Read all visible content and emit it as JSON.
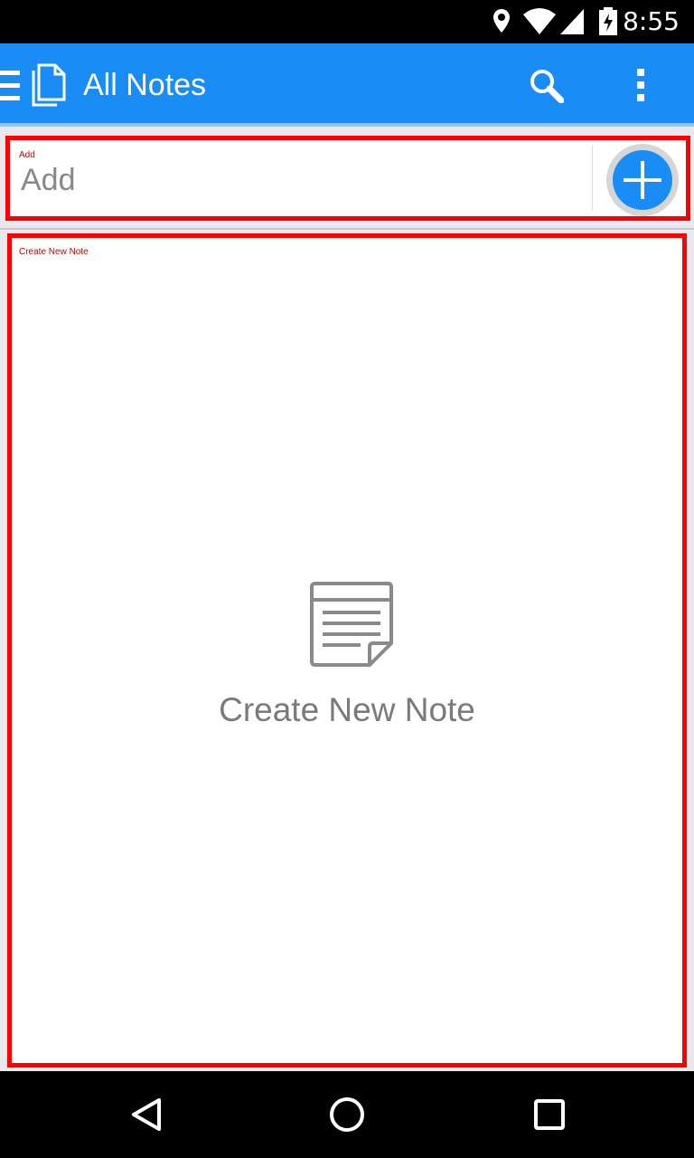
{
  "status_bar": {
    "time": "8:55",
    "icons": [
      "location-icon",
      "wifi-icon",
      "signal-icon",
      "battery-charging-icon"
    ]
  },
  "app_bar": {
    "title": "All Notes",
    "icons": [
      "menu-icon",
      "notes-app-icon",
      "search-icon",
      "overflow-menu-icon"
    ],
    "color": "#1a8cf6"
  },
  "add_section": {
    "label": "Add",
    "placeholder": "Add",
    "button_icon": "add-circle-icon"
  },
  "note_area": {
    "label": "Create New Note",
    "cta_text": "Create New Note",
    "icon": "note-document-icon"
  },
  "nav_bar": {
    "icons": [
      "back-icon",
      "home-icon",
      "recents-icon"
    ]
  },
  "colors": {
    "accent": "#1a8cf6",
    "highlight_border": "#ff0000"
  }
}
